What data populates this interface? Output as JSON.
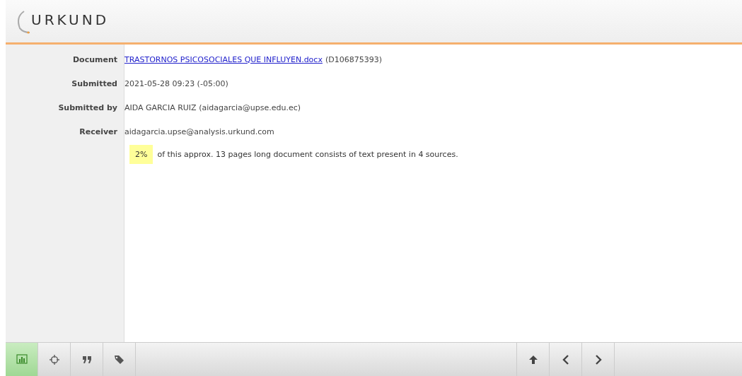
{
  "header": {
    "logo": "URKUND"
  },
  "details": [
    {
      "label": "Document",
      "kind": "link",
      "link": "TRASTORNOS PSICOSOCIALES QUE INFLUYEN.docx",
      "value": "(D106875393)"
    },
    {
      "label": "Submitted",
      "kind": "text",
      "value": "2021-05-28 09:23 (-05:00)"
    },
    {
      "label": "Submitted by",
      "kind": "text",
      "value": "AIDA GARCIA RUIZ (aidagarcia@upse.edu.ec)"
    },
    {
      "label": "Receiver",
      "kind": "text",
      "value": "aidagarcia.upse@analysis.urkund.com"
    }
  ],
  "summary": {
    "percent": "2%",
    "text": "of this approx. 13 pages long document consists of text present in 4 sources."
  },
  "toolbar": {
    "left": [
      {
        "selected": true
      },
      {
        "selected": false
      },
      {
        "selected": false
      },
      {
        "selected": false
      }
    ],
    "right": [
      {
        "selected": false
      },
      {
        "selected": false
      },
      {
        "selected": false
      }
    ]
  }
}
